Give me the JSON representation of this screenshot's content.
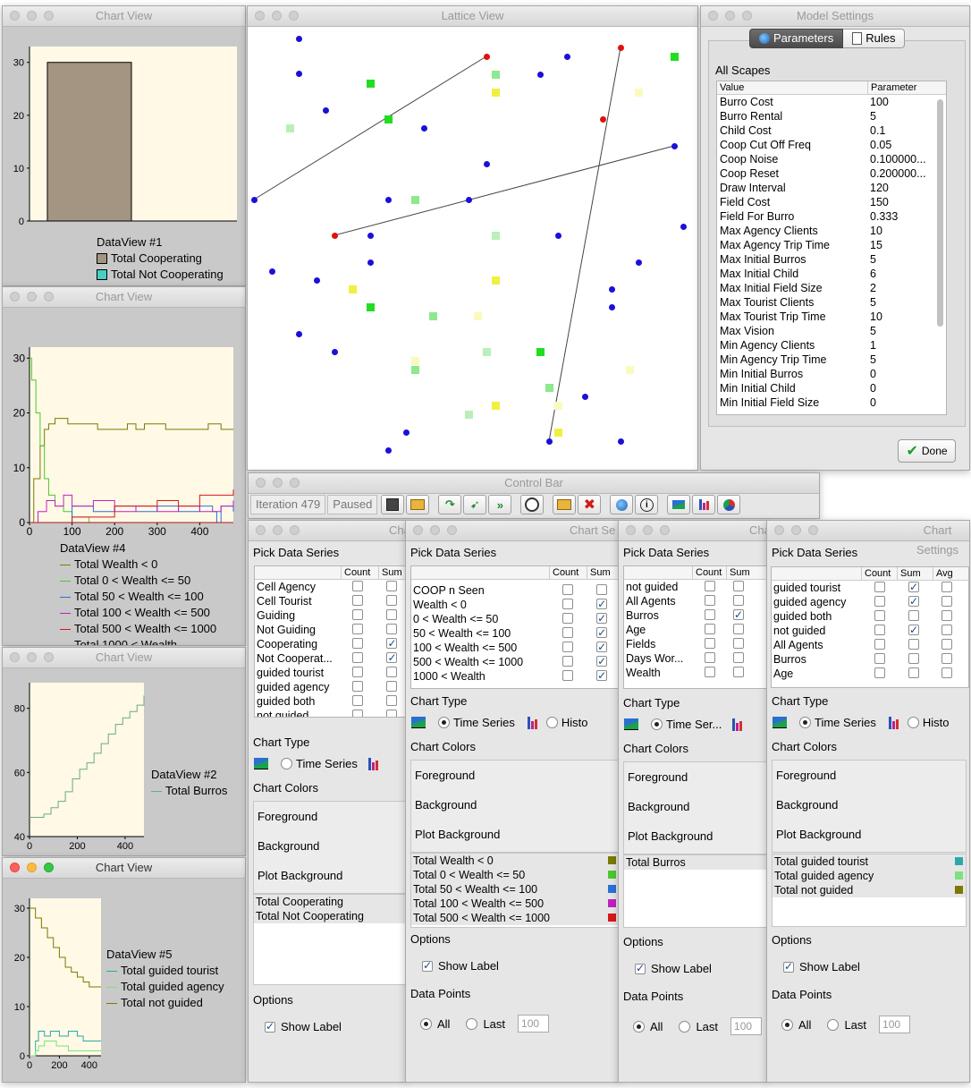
{
  "windows": {
    "chart_view_title": "Chart View",
    "lattice_title": "Lattice View",
    "model_settings_title": "Model Settings",
    "control_bar_title": "Control Bar",
    "chart_settings_title": "Chart Settings",
    "chart_settings_title_short": "Cha",
    "chart_settings_title_mid": "Chart Se"
  },
  "dataview1": {
    "title": "DataView #1",
    "legend": [
      "Total Cooperating",
      "Total Not Cooperating"
    ],
    "colors": [
      "#a39582",
      "#48d0c4"
    ]
  },
  "dataview4": {
    "title": "DataView #4",
    "legend": [
      "Total Wealth < 0",
      "Total 0 < Wealth <= 50",
      "Total 50 < Wealth <= 100",
      "Total 100 < Wealth <= 500",
      "Total 500 < Wealth <= 1000",
      "Total 1000 < Wealth"
    ],
    "colors": [
      "#7a7a00",
      "#4cc82c",
      "#2b6fd8",
      "#c020c0",
      "#d81818",
      "#b01818"
    ]
  },
  "dataview2": {
    "title": "DataView #2",
    "legend": [
      "Total Burros"
    ],
    "colors": [
      "#6aaa88"
    ]
  },
  "dataview5": {
    "title": "DataView #5",
    "legend": [
      "Total guided tourist",
      "Total guided agency",
      "Total not guided"
    ],
    "colors": [
      "#2aa8a8",
      "#7ee07e",
      "#7a7a00"
    ]
  },
  "chart_data": [
    {
      "type": "bar",
      "title": "DataView #1",
      "categories": [
        "Total Cooperating",
        "Total Not Cooperating"
      ],
      "values": [
        30,
        0
      ],
      "yticks": [
        "0",
        "10",
        "20",
        "30"
      ],
      "ylim": [
        0,
        33
      ]
    },
    {
      "type": "line",
      "title": "DataView #4",
      "xlim": [
        0,
        479
      ],
      "ylim": [
        0,
        32
      ],
      "xticks": [
        "0",
        "100",
        "200",
        "300",
        "400"
      ],
      "yticks": [
        "0",
        "10",
        "20",
        "30"
      ],
      "series": [
        {
          "name": "Total Wealth < 0",
          "x": [
            0,
            10,
            25,
            35,
            45,
            60,
            90,
            150,
            160,
            200,
            230,
            250,
            270,
            300,
            320,
            350,
            400,
            420,
            450,
            479
          ],
          "y": [
            0,
            8,
            14,
            17,
            18,
            19,
            18,
            18,
            17,
            17,
            18,
            17,
            18,
            18,
            17,
            17,
            17,
            18,
            17,
            17
          ]
        },
        {
          "name": "Total 0 < Wealth <= 50",
          "x": [
            0,
            5,
            15,
            25,
            35,
            45,
            60,
            80,
            100,
            120,
            140,
            479
          ],
          "y": [
            30,
            26,
            20,
            14,
            8,
            5,
            3,
            2,
            1,
            1,
            0,
            0
          ]
        },
        {
          "name": "Total 50 < Wealth <= 100",
          "x": [
            0,
            100,
            150,
            200,
            250,
            300,
            350,
            400,
            430,
            440,
            450,
            479
          ],
          "y": [
            0,
            3,
            2,
            3,
            2,
            3,
            2,
            3,
            2,
            0,
            3,
            2
          ]
        },
        {
          "name": "Total 100 < Wealth <= 500",
          "x": [
            0,
            20,
            40,
            60,
            80,
            100,
            150,
            200,
            250,
            300,
            350,
            400,
            450,
            479
          ],
          "y": [
            0,
            2,
            4,
            3,
            5,
            3,
            4,
            2,
            3,
            2,
            3,
            2,
            3,
            4
          ]
        },
        {
          "name": "Total 500 < Wealth <= 1000",
          "x": [
            0,
            100,
            200,
            300,
            350,
            400,
            450,
            479
          ],
          "y": [
            0,
            1,
            3,
            4,
            3,
            5,
            5,
            6
          ]
        },
        {
          "name": "Total 1000 < Wealth",
          "x": [
            0,
            479
          ],
          "y": [
            0,
            0
          ]
        }
      ]
    },
    {
      "type": "line",
      "title": "DataView #2",
      "xlim": [
        0,
        479
      ],
      "ylim": [
        40,
        88
      ],
      "xticks": [
        "0",
        "200",
        "400"
      ],
      "yticks": [
        "40",
        "60",
        "80"
      ],
      "series": [
        {
          "name": "Total Burros",
          "x": [
            0,
            30,
            60,
            90,
            120,
            150,
            180,
            210,
            240,
            270,
            300,
            330,
            360,
            390,
            420,
            450,
            479
          ],
          "y": [
            46,
            46,
            47,
            49,
            51,
            54,
            58,
            61,
            63,
            66,
            69,
            72,
            75,
            77,
            79,
            81,
            84
          ]
        }
      ]
    },
    {
      "type": "line",
      "title": "DataView #5",
      "xlim": [
        0,
        479
      ],
      "ylim": [
        0,
        32
      ],
      "xticks": [
        "0",
        "200",
        "400"
      ],
      "yticks": [
        "0",
        "10",
        "20",
        "30"
      ],
      "series": [
        {
          "name": "Total guided tourist",
          "x": [
            0,
            40,
            60,
            100,
            140,
            200,
            260,
            320,
            360,
            479
          ],
          "y": [
            0,
            3,
            5,
            4,
            5,
            4,
            5,
            4,
            3,
            3
          ]
        },
        {
          "name": "Total guided agency",
          "x": [
            0,
            40,
            60,
            100,
            180,
            260,
            479
          ],
          "y": [
            0,
            1,
            2,
            3,
            2,
            1,
            1
          ]
        },
        {
          "name": "Total not guided",
          "x": [
            0,
            40,
            80,
            120,
            160,
            200,
            240,
            280,
            320,
            360,
            400,
            479
          ],
          "y": [
            30,
            28,
            26,
            24,
            22,
            20,
            18,
            17,
            16,
            15,
            14,
            14
          ]
        }
      ]
    }
  ],
  "model_settings": {
    "tabs": [
      "Parameters",
      "Rules"
    ],
    "scope_label": "All Scapes",
    "headers": [
      "Value",
      "Parameter"
    ],
    "rows": [
      [
        "Burro Cost",
        "100"
      ],
      [
        "Burro Rental",
        "5"
      ],
      [
        "Child Cost",
        "0.1"
      ],
      [
        "Coop Cut Off Freq",
        "0.05"
      ],
      [
        "Coop Noise",
        "0.100000..."
      ],
      [
        "Coop Reset",
        "0.200000..."
      ],
      [
        "Draw Interval",
        "120"
      ],
      [
        "Field Cost",
        "150"
      ],
      [
        "Field For Burro",
        "0.333"
      ],
      [
        "Max Agency Clients",
        "10"
      ],
      [
        "Max Agency Trip Time",
        "15"
      ],
      [
        "Max Initial Burros",
        "5"
      ],
      [
        "Max Initial Child",
        "6"
      ],
      [
        "Max Initial Field Size",
        "2"
      ],
      [
        "Max Tourist Clients",
        "5"
      ],
      [
        "Max Tourist Trip Time",
        "10"
      ],
      [
        "Max Vision",
        "5"
      ],
      [
        "Min Agency Clients",
        "1"
      ],
      [
        "Min Agency Trip Time",
        "5"
      ],
      [
        "Min Initial Burros",
        "0"
      ],
      [
        "Min Initial Child",
        "0"
      ],
      [
        "Min Initial Field Size",
        "0"
      ]
    ],
    "done_label": "Done"
  },
  "control_bar": {
    "iteration": "Iteration 479",
    "status": "Paused",
    "icons": [
      "save-icon",
      "open-folder-icon",
      "step-icon",
      "run-icon",
      "fast-forward-icon",
      "stop-watch-icon",
      "folder-icon",
      "close-icon",
      "globe-icon",
      "info-icon",
      "chart-icon",
      "bar-chart-icon",
      "pie-icon"
    ]
  },
  "chart_settings_common": {
    "pick_label": "Pick Data Series",
    "count_label": "Count",
    "sum_label": "Sum",
    "avg_label": "Avg",
    "chart_type_label": "Chart Type",
    "time_series": "Time Series",
    "time_series_short": "Time Ser...",
    "histogram_short": "Histo",
    "chart_colors_label": "Chart Colors",
    "foreground": "Foreground",
    "background": "Background",
    "plot_background": "Plot Background",
    "options_label": "Options",
    "show_label": "Show Label",
    "data_points_label": "Data Points",
    "all_label": "All",
    "last_label": "Last",
    "last_value": "100"
  },
  "cs1": {
    "rows": [
      {
        "name": "Cell Agency",
        "count": false,
        "sum": false
      },
      {
        "name": "Cell Tourist",
        "count": false,
        "sum": false
      },
      {
        "name": "Guiding",
        "count": false,
        "sum": false
      },
      {
        "name": "Not Guiding",
        "count": false,
        "sum": false
      },
      {
        "name": "Cooperating",
        "count": false,
        "sum": true
      },
      {
        "name": "Not Cooperat...",
        "count": false,
        "sum": true
      },
      {
        "name": "guided tourist",
        "count": false,
        "sum": false
      },
      {
        "name": "guided agency",
        "count": false,
        "sum": false
      },
      {
        "name": "guided both",
        "count": false,
        "sum": false
      },
      {
        "name": "not guided",
        "count": false,
        "sum": false
      }
    ],
    "series": [
      "Total Cooperating",
      "Total Not Cooperating"
    ]
  },
  "cs2": {
    "rows": [
      {
        "name": "COOP n Seen",
        "count": false,
        "sum": false
      },
      {
        "name": "Wealth < 0",
        "count": false,
        "sum": true
      },
      {
        "name": "0 < Wealth <= 50",
        "count": false,
        "sum": true
      },
      {
        "name": "50 < Wealth <= 100",
        "count": false,
        "sum": true
      },
      {
        "name": "100 < Wealth <= 500",
        "count": false,
        "sum": true
      },
      {
        "name": "500 < Wealth <= 1000",
        "count": false,
        "sum": true
      },
      {
        "name": "1000 < Wealth",
        "count": false,
        "sum": true
      }
    ],
    "series": [
      {
        "name": "Total Wealth < 0",
        "color": "#7a7a00"
      },
      {
        "name": "Total 0 < Wealth <= 50",
        "color": "#4cc82c"
      },
      {
        "name": "Total 50 < Wealth <= 100",
        "color": "#2b6fd8"
      },
      {
        "name": "Total 100 < Wealth <= 500",
        "color": "#c020c0"
      },
      {
        "name": "Total 500 < Wealth <= 1000",
        "color": "#d81818"
      }
    ]
  },
  "cs3": {
    "rows": [
      {
        "name": "not guided",
        "count": false,
        "sum": false
      },
      {
        "name": "All Agents",
        "count": false,
        "sum": false
      },
      {
        "name": "Burros",
        "count": false,
        "sum": true
      },
      {
        "name": "Age",
        "count": false,
        "sum": false
      },
      {
        "name": "Fields",
        "count": false,
        "sum": false
      },
      {
        "name": "Days Wor...",
        "count": false,
        "sum": false
      },
      {
        "name": "Wealth",
        "count": false,
        "sum": false
      }
    ],
    "series": [
      "Total Burros"
    ]
  },
  "cs4": {
    "rows": [
      {
        "name": "guided tourist",
        "count": false,
        "sum": true,
        "avg": false
      },
      {
        "name": "guided agency",
        "count": false,
        "sum": true,
        "avg": false
      },
      {
        "name": "guided both",
        "count": false,
        "sum": false,
        "avg": false
      },
      {
        "name": "not guided",
        "count": false,
        "sum": true,
        "avg": false
      },
      {
        "name": "All Agents",
        "count": false,
        "sum": false,
        "avg": false
      },
      {
        "name": "Burros",
        "count": false,
        "sum": false,
        "avg": false
      },
      {
        "name": "Age",
        "count": false,
        "sum": false,
        "avg": false
      }
    ],
    "series": [
      {
        "name": "Total guided tourist",
        "color": "#2aa8a8"
      },
      {
        "name": "Total guided agency",
        "color": "#7ee07e"
      },
      {
        "name": "Total not guided",
        "color": "#7a7a00"
      }
    ]
  }
}
